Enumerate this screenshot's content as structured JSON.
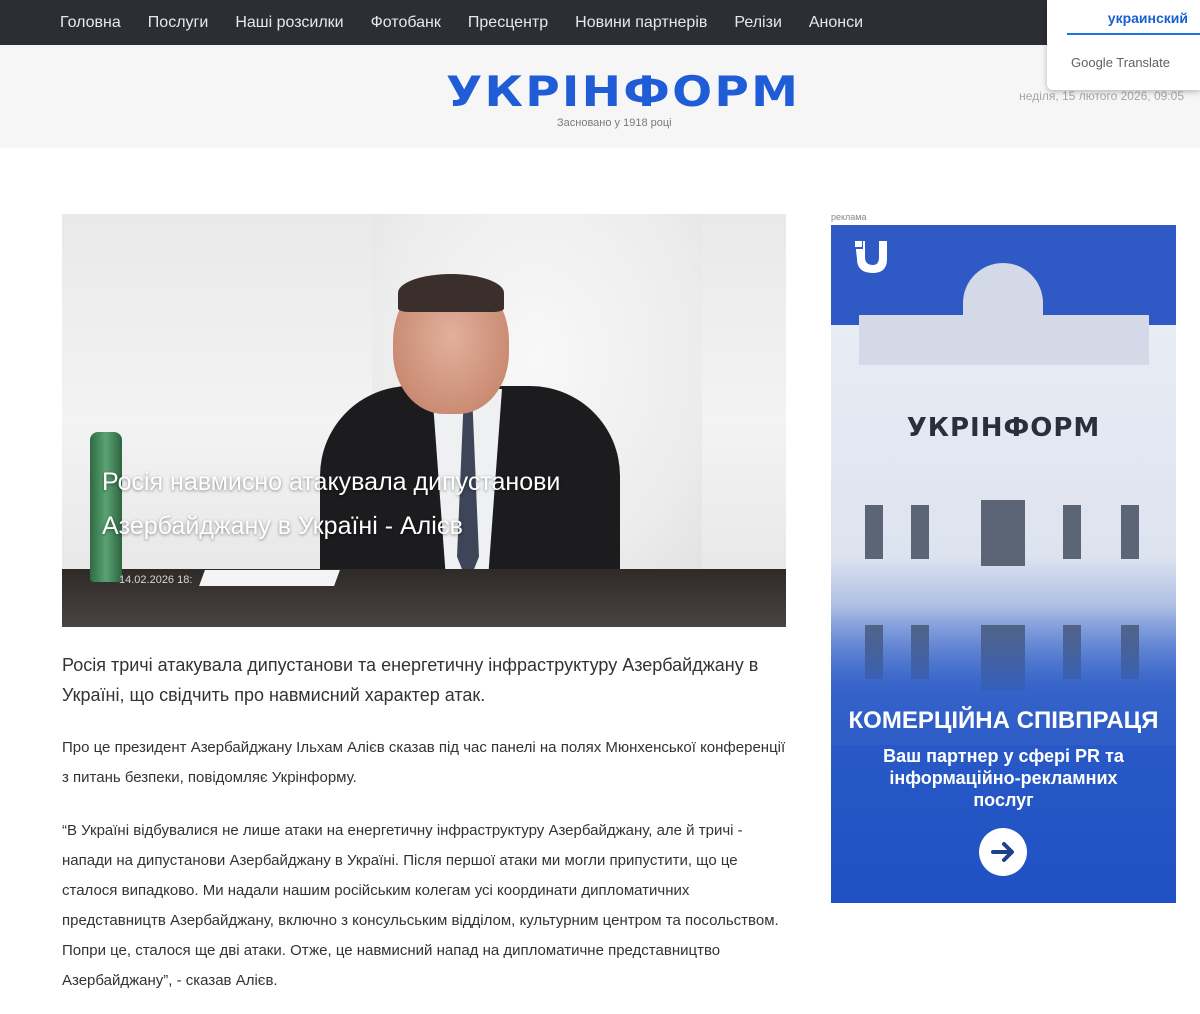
{
  "nav": {
    "items": [
      "Головна",
      "Послуги",
      "Наші розсилки",
      "Фотобанк",
      "Пресцентр",
      "Новини партнерів",
      "Релізи",
      "Анонси"
    ]
  },
  "translate": {
    "language": "украинский",
    "powered_by": "Google Translate"
  },
  "header": {
    "logo": "УКРІНФОРМ",
    "tagline": "Засновано у 1918 році",
    "date": "неділя, 15 лютого 2026, 09:05"
  },
  "article": {
    "title": "Росія навмисно атакувала дипустанови Азербайджану в Україні - Алієв",
    "datetime": "14.02.2026 18:",
    "lead": "Росія тричі атакувала дипустанови та енергетичну інфраструктуру Азербайджану в Україні, що свідчить про навмисний характер атак.",
    "paragraphs": [
      "Про це президент Азербайджану Ільхам Алієв сказав під час панелі на полях Мюнхенської конференції з питань безпеки, повідомляє Укрінформу.",
      "“В Україні відбувалися не лише атаки на енергетичну інфраструктуру Азербайджану, але й тричі - напади на дипустанови Азербайджану в Україні. Після першої атаки ми могли припустити, що це сталося випадково. Ми надали нашим російським колегам усі координати дипломатичних представництв Азербайджану, включно з консульським відділом, культурним центром та посольством. Попри це, сталося ще дві атаки. Отже, це навмисний напад на дипломатичне представництво Азербайджану”, - сказав Алієв."
    ]
  },
  "ad": {
    "label": "реклама",
    "building_sign": "УКРІНФОРМ",
    "heading": "КОМЕРЦІЙНА СПІВПРАЦЯ",
    "subheading": "Ваш партнер у сфері PR та інформаційно-рекламних послуг",
    "button_icon": "arrow-right-icon"
  },
  "colors": {
    "nav_bg": "#2b2e33",
    "brand_blue": "#1f5cd6",
    "ad_blue": "#2f5ec8"
  }
}
